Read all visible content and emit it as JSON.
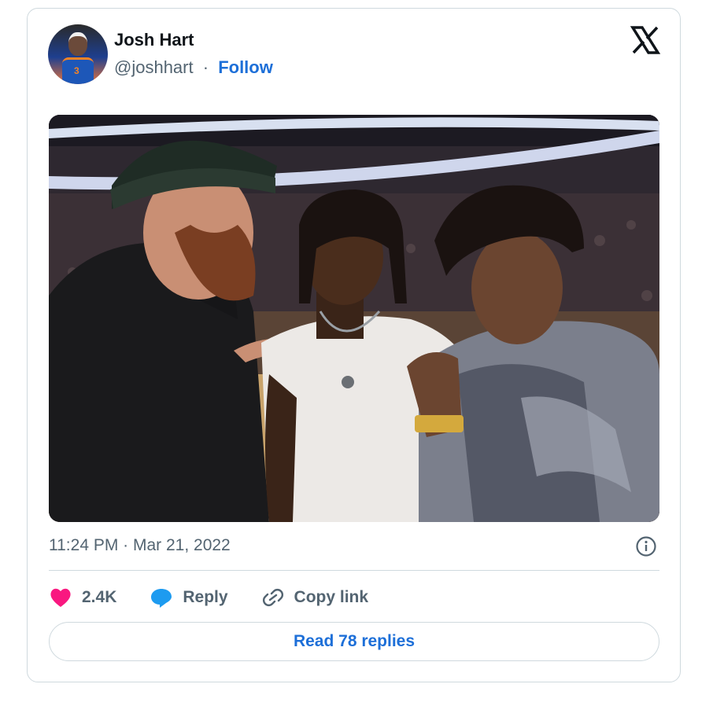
{
  "author": {
    "name": "Josh Hart",
    "handle": "@joshhart",
    "separator": "·",
    "follow_label": "Follow"
  },
  "photo": {
    "description_icon": "photo-image"
  },
  "timestamp": "11:24 PM · Mar 21, 2022",
  "actions": {
    "likes_count": "2.4K",
    "reply_label": "Reply",
    "copy_label": "Copy link"
  },
  "read_replies_label": "Read 78 replies",
  "colors": {
    "link_blue": "#1d6fd8",
    "heart_pink": "#f91880",
    "reply_blue": "#1d9bf0",
    "muted": "#536471",
    "border": "#cfd9de"
  }
}
